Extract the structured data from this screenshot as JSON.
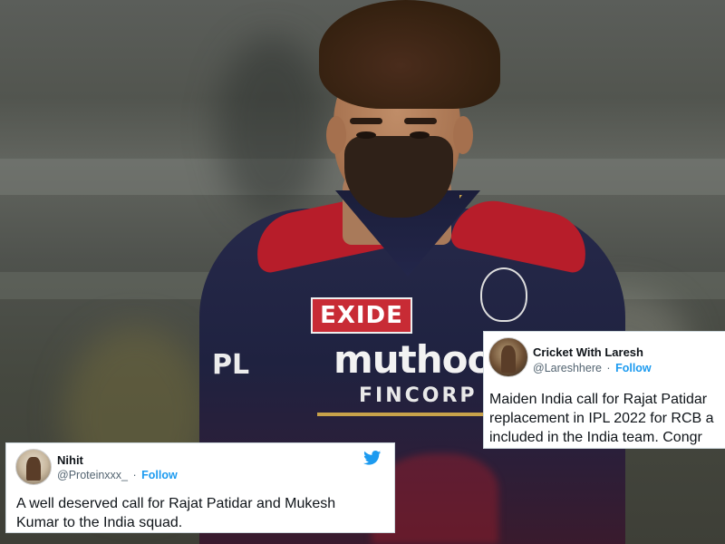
{
  "photo": {
    "jersey_sponsor": "EXIDE",
    "jersey_main_sponsor": "muthoot",
    "jersey_sub_sponsor": "FINCORP",
    "jersey_league": "PL",
    "colors": {
      "jersey": "#22254a",
      "accent_red": "#c82b35",
      "trim_gold": "#c8a24a"
    }
  },
  "tweets": [
    {
      "name": "Nihit",
      "handle": "@Proteinxxx_",
      "separator": "·",
      "follow_label": "Follow",
      "body_lines": [
        "A well deserved call for Rajat Patidar and Mukesh",
        "Kumar to the India squad."
      ],
      "icon": "twitter-bird-icon",
      "avatar_icon": "user-avatar"
    },
    {
      "name": "Cricket With Laresh",
      "handle": "@Lareshhere",
      "separator": "·",
      "follow_label": "Follow",
      "body_lines": [
        "Maiden India call for Rajat Patidar",
        "replacement in IPL 2022 for RCB a",
        "included in the India team. Congr"
      ],
      "avatar_icon": "user-avatar"
    }
  ],
  "colors": {
    "follow": "#1d9bf0",
    "handle": "#536471",
    "text": "#0f1419"
  }
}
